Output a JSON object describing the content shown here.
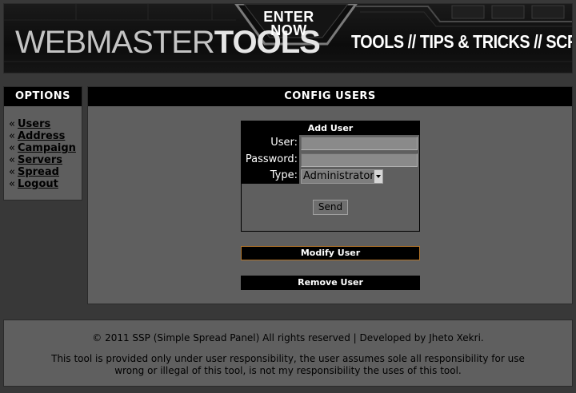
{
  "banner": {
    "logo_part1": "WEBMASTER",
    "logo_part2": "TOOLS",
    "enter_line1": "ENTER",
    "enter_line2": "NOW",
    "tagline": "TOOLS // TIPS & TRICKS // SCRIPTS"
  },
  "sidebar": {
    "title": "OPTIONS",
    "bullet": "«",
    "items": [
      {
        "label": "Users"
      },
      {
        "label": "Address"
      },
      {
        "label": "Campaign"
      },
      {
        "label": "Servers"
      },
      {
        "label": "Spread"
      },
      {
        "label": "Logout"
      }
    ]
  },
  "main": {
    "title": "CONFIG USERS",
    "form": {
      "title": "Add User",
      "user_label": "User:",
      "user_value": "",
      "password_label": "Password:",
      "password_value": "",
      "type_label": "Type:",
      "type_selected": "Administrator",
      "send_label": "Send"
    },
    "modify_label": "Modify User",
    "remove_label": "Remove User"
  },
  "footer": {
    "copyright": "© 2011 SSP (Simple Spread Panel) All rights reserved | Developed by Jheto Xekri.",
    "disclaimer": "This tool is provided only under user responsibility, the user assumes sole all responsibility for use wrong or illegal of this tool, is not my responsibility the uses of this tool."
  },
  "colors": {
    "page_bg": "#383838",
    "panel_bg": "#5f5f5f",
    "header_bg": "#000000",
    "modify_border": "#b2742a"
  }
}
